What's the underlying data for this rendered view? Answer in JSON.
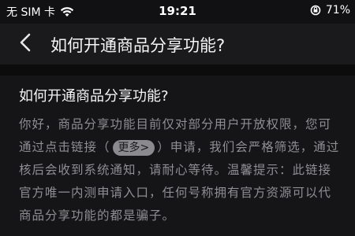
{
  "status_bar": {
    "carrier": "无 SIM 卡",
    "time": "19:21",
    "battery": "71%"
  },
  "nav": {
    "back_icon": "chevron-left-icon",
    "title": "如何开通商品分享功能?"
  },
  "article": {
    "title": "如何开通商品分享功能?",
    "line1": "你好，商品分享功能目前仅对部分用户开放权限，您可",
    "line2_prefix": "通过点击链接（",
    "more_link": "更多>",
    "line2_suffix": "）申请，我们会严格筛选，通过",
    "line3": "核后会收到系统通知，请耐心等待。温馨提示：此链接",
    "line4": "官方唯一内测申请入口，任何号称拥有官方资源可以代",
    "line5": "商品分享功能的都是骗子。"
  }
}
